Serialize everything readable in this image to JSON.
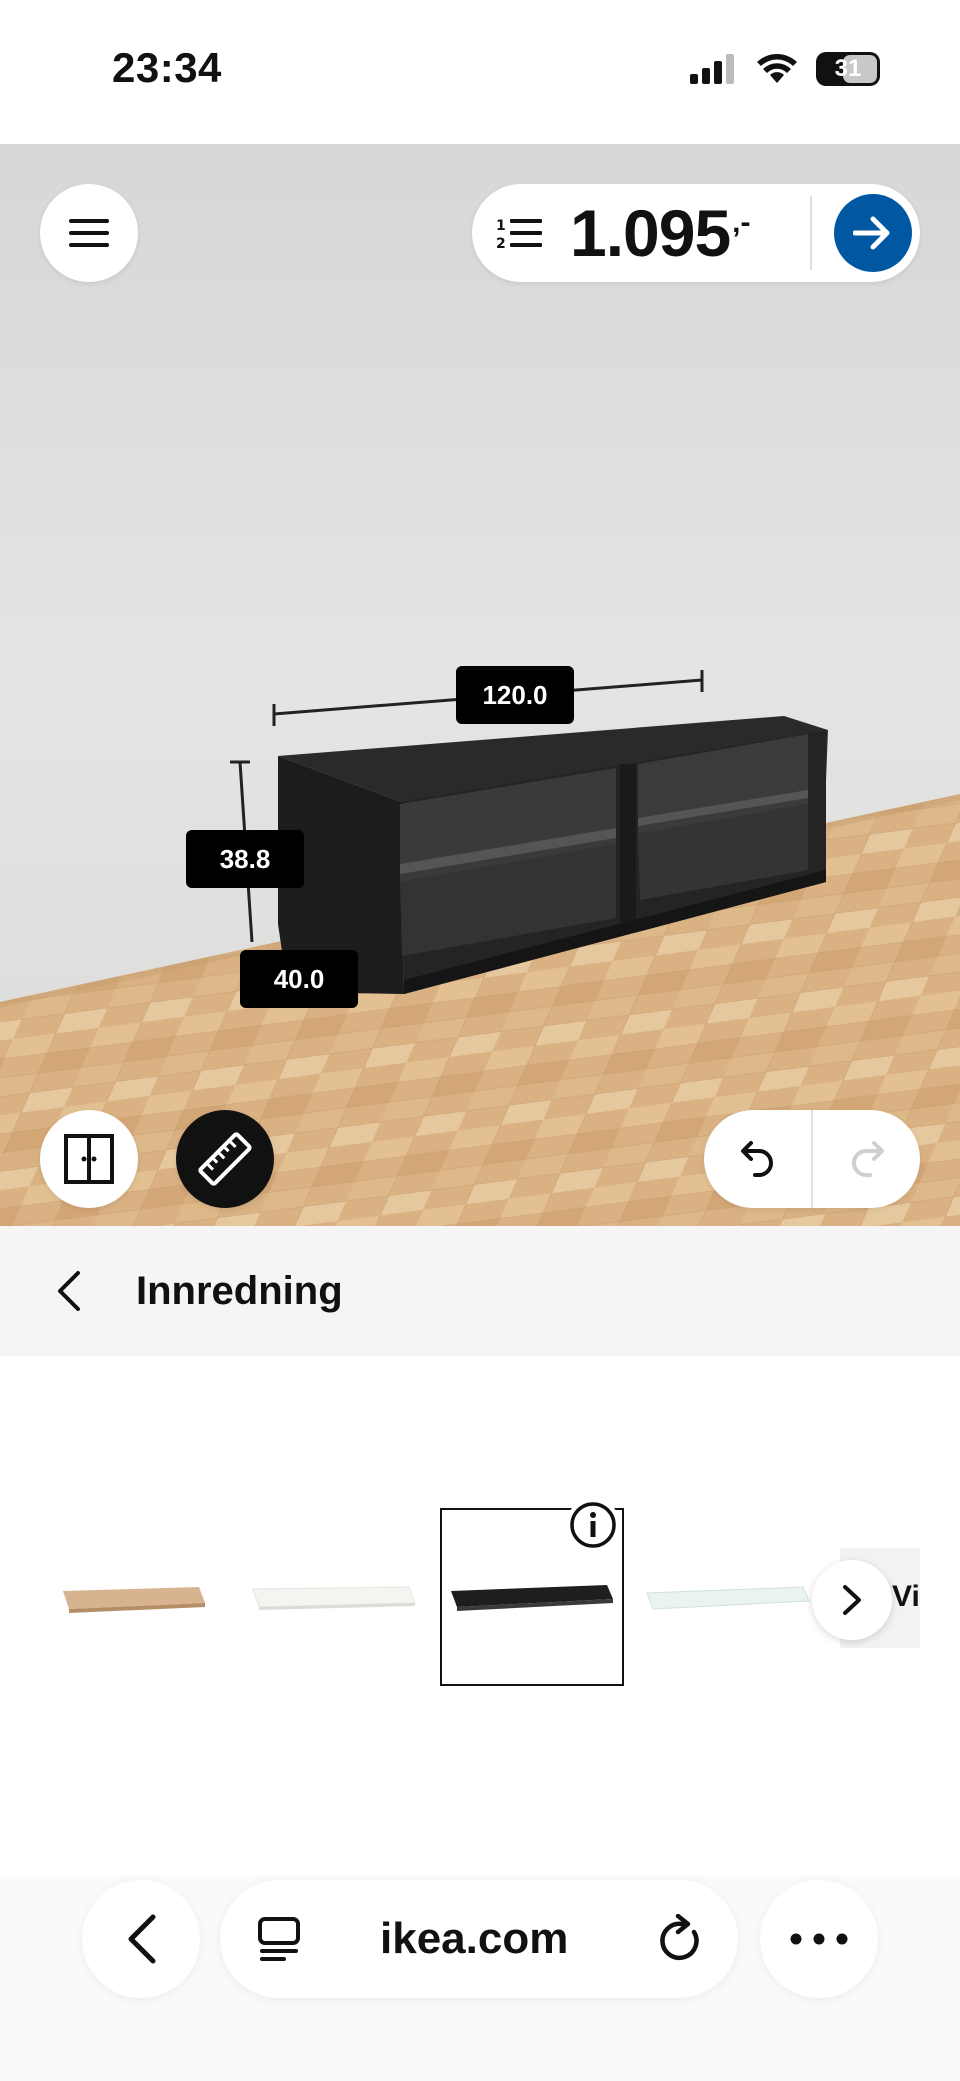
{
  "status_bar": {
    "time": "23:34",
    "battery": "31",
    "icons": [
      "signal-icon",
      "wifi-icon",
      "battery-icon"
    ]
  },
  "planner": {
    "menu_icon": "hamburger-menu-icon",
    "price": {
      "list_icon": "numbered-list-icon",
      "value": "1.095",
      "suffix": ",-",
      "go_icon": "arrow-right-icon"
    },
    "dimensions": {
      "width": "120.0",
      "height": "38.8",
      "depth": "40.0"
    },
    "tools": {
      "door_icon": "door-toggle-icon",
      "measure_icon": "ruler-icon",
      "undo_icon": "undo-icon",
      "redo_icon": "redo-icon"
    }
  },
  "category": {
    "title": "Innredning",
    "back_icon": "chevron-left-icon"
  },
  "options": {
    "items": [
      {
        "name": "oak-effect",
        "color": "#d7b48f",
        "selected": false
      },
      {
        "name": "white",
        "color": "#f2f2ee",
        "selected": false
      },
      {
        "name": "black-brown",
        "color": "#1e1e1e",
        "selected": true
      },
      {
        "name": "glass",
        "color": "#e4f0ea",
        "selected": false
      }
    ],
    "more_label": "Vi",
    "info_icon": "info-icon",
    "next_icon": "chevron-right-icon"
  },
  "browser": {
    "url": "ikea.com",
    "back_icon": "chevron-left-icon",
    "tabs_icon": "reader-icon",
    "reload_icon": "reload-icon",
    "more_icon": "more-dots-icon"
  },
  "colors": {
    "accent": "#0058a3",
    "furniture": "#1e1e1e",
    "floor": "#d9b182"
  }
}
